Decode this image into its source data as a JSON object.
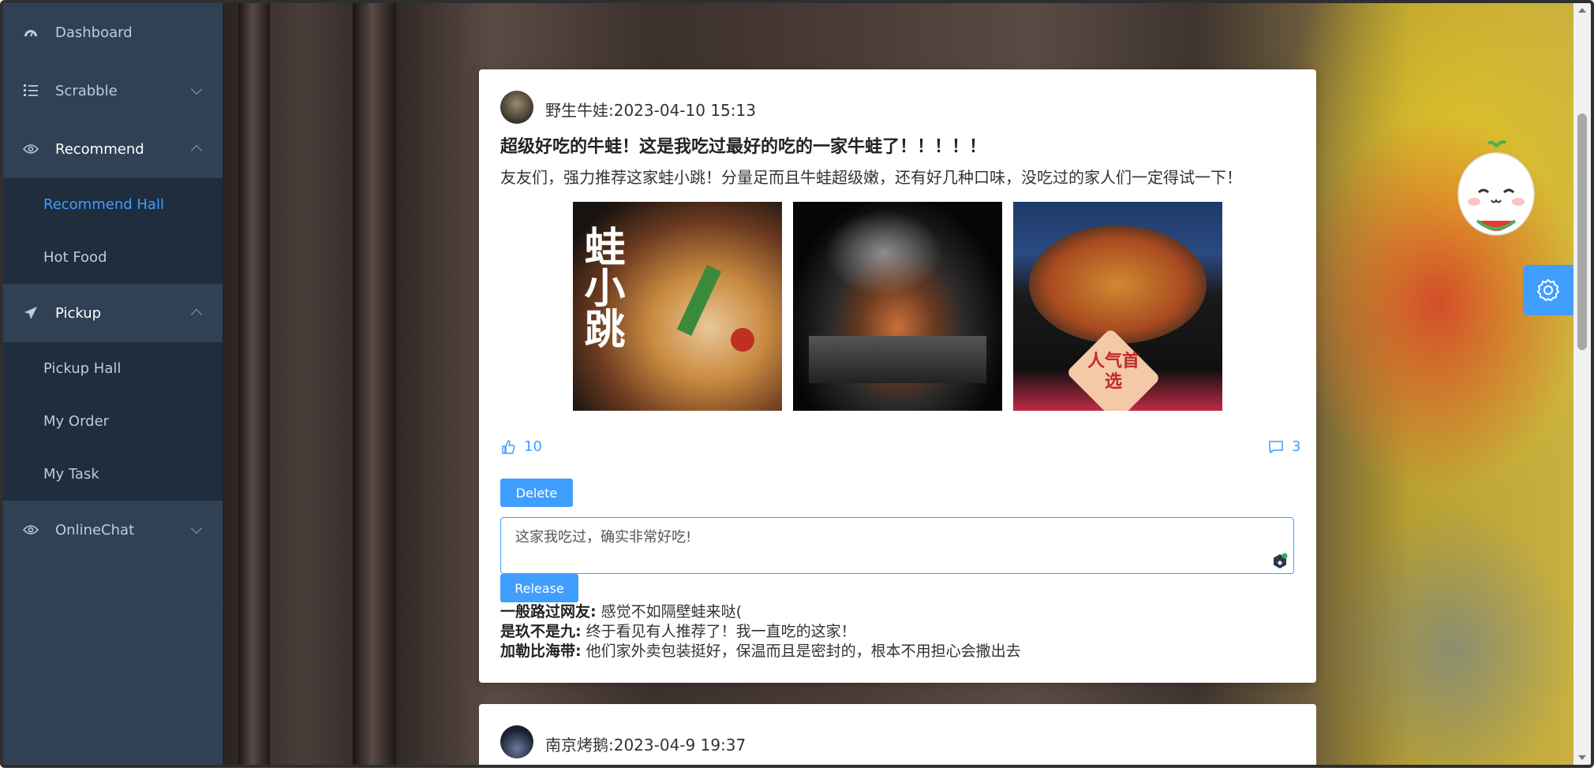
{
  "sidebar": {
    "items": [
      {
        "label": "Dashboard",
        "icon": "dashboard-icon"
      },
      {
        "label": "Scrabble",
        "icon": "list-icon",
        "chevron": "down"
      },
      {
        "label": "Recommend",
        "icon": "eye-icon",
        "chevron": "up"
      },
      {
        "label": "Pickup",
        "icon": "send-icon",
        "chevron": "up"
      },
      {
        "label": "OnlineChat",
        "icon": "eye-icon",
        "chevron": "down"
      }
    ],
    "recommend_sub": [
      "Recommend Hall",
      "Hot Food"
    ],
    "pickup_sub": [
      "Pickup Hall",
      "My Order",
      "My Task"
    ],
    "active_item": "Recommend Hall"
  },
  "post": {
    "author_line": "野生牛娃:2023-04-10 15:13",
    "title": "超级好吃的牛蛙！这是我吃过最好的吃的一家牛蛙了！！！！！",
    "body": "友友们，强力推荐这家蛙小跳！分量足而且牛蛙超级嫩，还有好几种口味，没吃过的家人们一定得试一下！",
    "images": [
      "frog-pot-image",
      "steaming-grill-image",
      "spicy-frog-bowl-image"
    ],
    "image1_text": "蛙小跳",
    "image3_badge": "人气首选",
    "likes": "10",
    "comments_count": "3",
    "delete_label": "Delete",
    "comment_input_value": "这家我吃过，确实非常好吃!",
    "release_label": "Release",
    "comments": [
      {
        "user": "一般路过网友:",
        "text": " 感觉不如隔壁蛙来哒("
      },
      {
        "user": "是玖不是九:",
        "text": " 终于看见有人推荐了！我一直吃的这家！"
      },
      {
        "user": "加勒比海带:",
        "text": " 他们家外卖包装挺好，保温而且是密封的，根本不用担心会撒出去"
      }
    ]
  },
  "post2": {
    "author_line": "南京烤鹅:2023-04-9 19:37"
  },
  "colors": {
    "sidebar_bg": "#304156",
    "submenu_bg": "#1f2d3d",
    "accent": "#409eff"
  },
  "floating": {
    "mascot": "watermelon-mascot-icon",
    "settings": "gear-icon"
  }
}
